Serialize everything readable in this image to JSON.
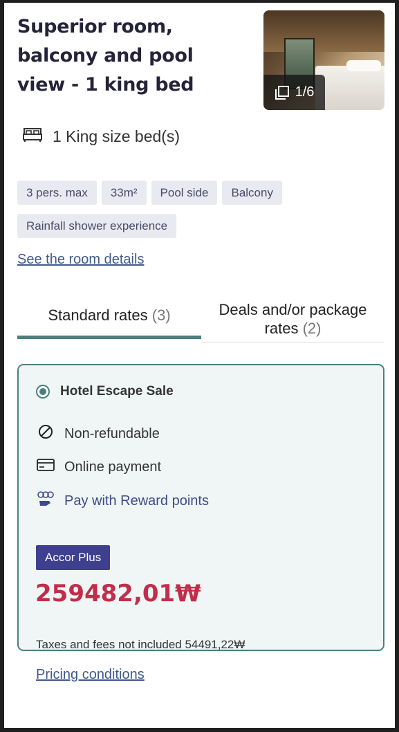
{
  "room": {
    "title": "Superior room, balcony and pool view - 1 king bed",
    "gallery_counter": "1/6",
    "bed": "1 King size bed(s)",
    "tags": [
      "3 pers. max",
      "33m²",
      "Pool side",
      "Balcony",
      "Rainfall shower experience"
    ],
    "details_link": "See the room details"
  },
  "tabs": {
    "standard_label": "Standard rates",
    "standard_count": "(3)",
    "deals_label": "Deals and/or package rates",
    "deals_count": "(2)"
  },
  "offer": {
    "name": "Hotel Escape Sale",
    "features": {
      "refund": "Non-refundable",
      "payment": "Online payment",
      "reward": "Pay with Reward points"
    },
    "badge": "Accor Plus",
    "price": "259482,01₩",
    "taxes": "Taxes and fees not included 54491,22₩",
    "pricing_link": "Pricing conditions"
  },
  "colors": {
    "accent": "#4b7f7e",
    "price": "#c22d4a",
    "badge": "#3e3f8f",
    "link": "#3f5a8a"
  },
  "icons": [
    "bed-icon",
    "gallery-icon",
    "radio-selected-icon",
    "no-refund-icon",
    "credit-card-icon",
    "reward-points-icon"
  ]
}
